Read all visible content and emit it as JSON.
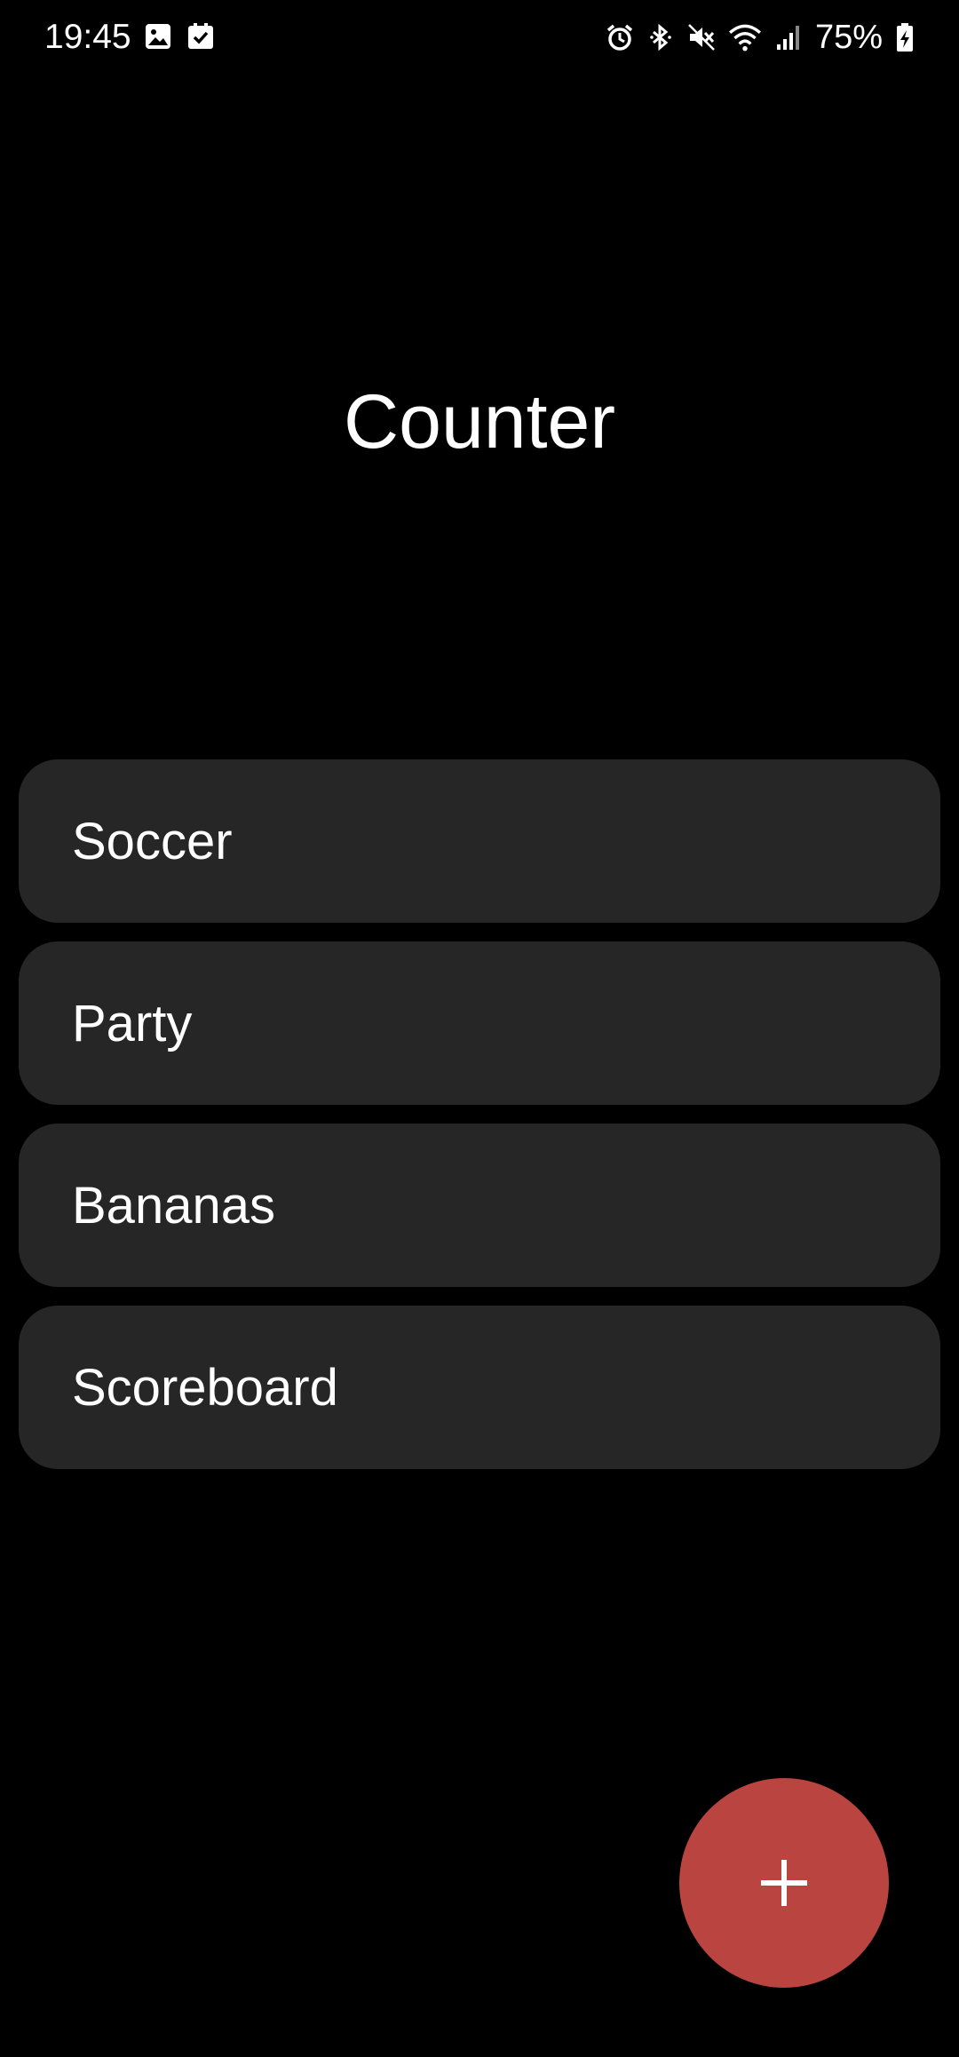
{
  "status_bar": {
    "time": "19:45",
    "left_icons": [
      "image-icon",
      "checkbox-icon"
    ],
    "right_icons": [
      "alarm-icon",
      "bluetooth-icon",
      "mute-icon",
      "wifi-icon",
      "signal-icon"
    ],
    "battery_percent": "75%"
  },
  "header": {
    "title": "Counter"
  },
  "counters": [
    {
      "label": "Soccer"
    },
    {
      "label": "Party"
    },
    {
      "label": "Bananas"
    },
    {
      "label": "Scoreboard"
    }
  ],
  "fab": {
    "icon": "plus-icon",
    "color": "#b94440"
  },
  "colors": {
    "background": "#000000",
    "card": "#262626",
    "accent": "#b94440"
  }
}
